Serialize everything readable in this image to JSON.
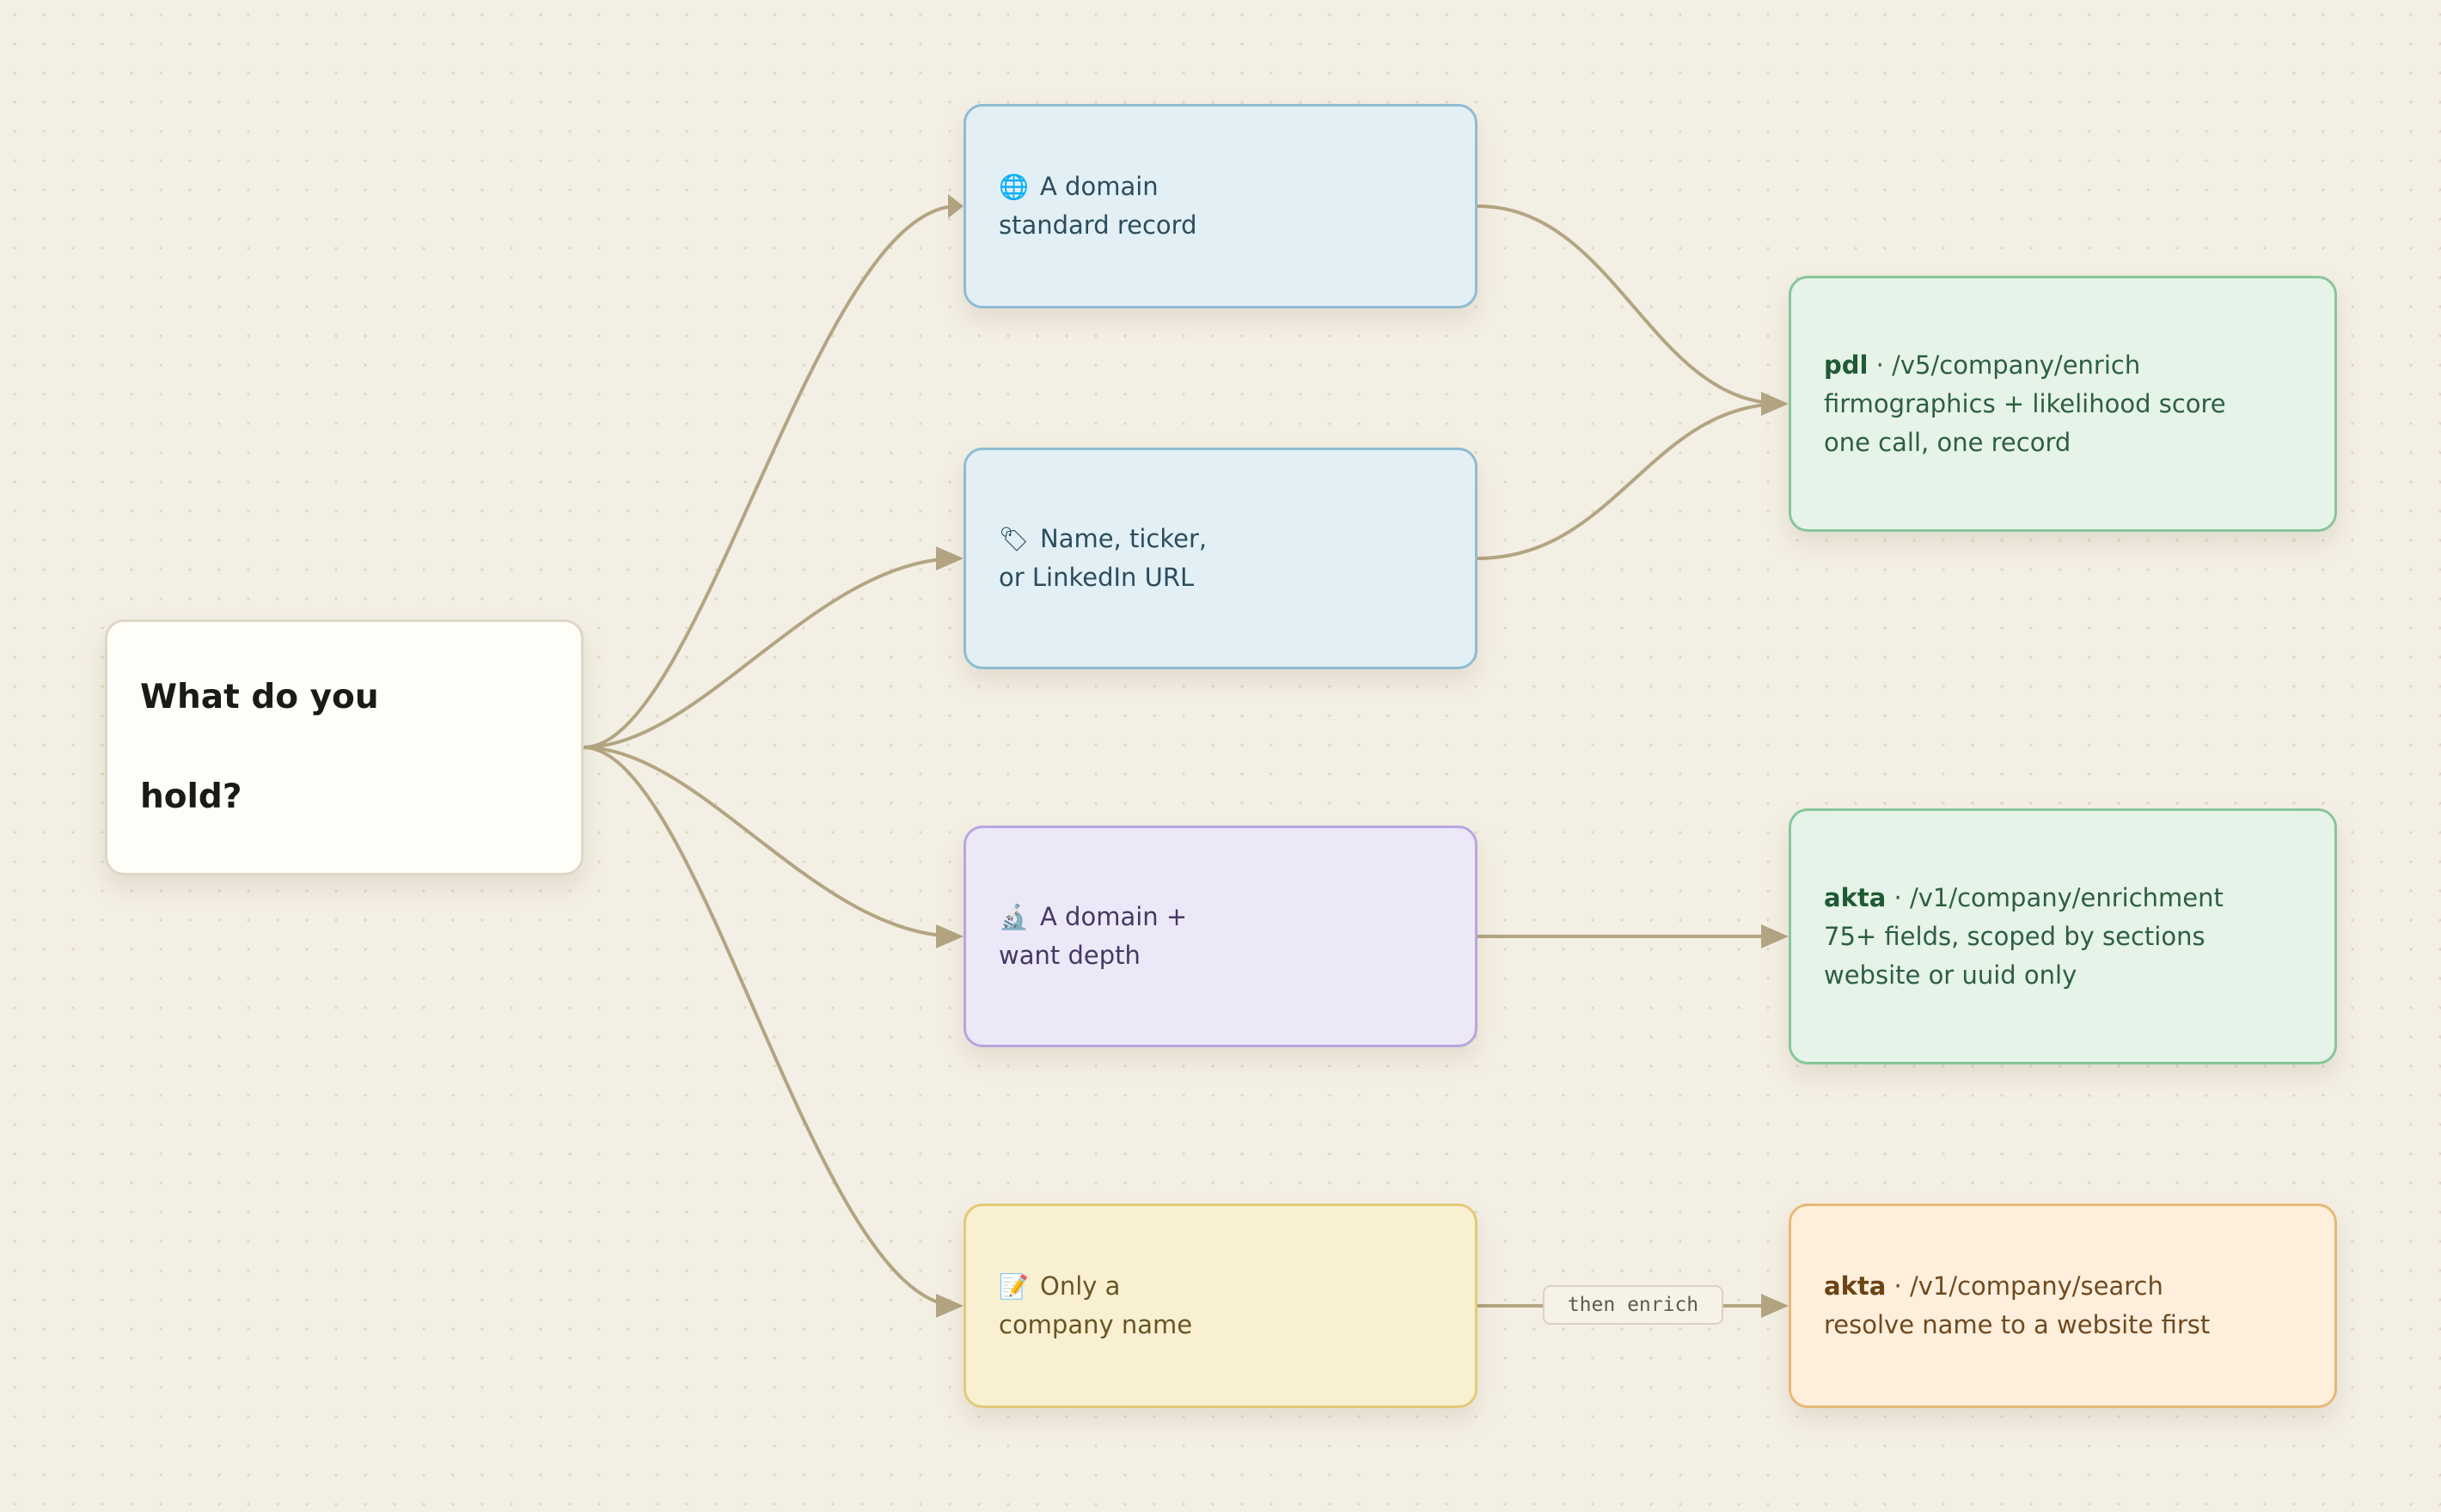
{
  "root": {
    "line1": "What do you",
    "line2": "hold?"
  },
  "inputs": [
    {
      "key": "domain",
      "icon": "globe-icon",
      "glyph": "🌐",
      "line1": "A domain",
      "line2": "standard record"
    },
    {
      "key": "name",
      "icon": "tag-icon",
      "glyph": "🏷",
      "line1": "Name, ticker,",
      "line2": "or LinkedIn URL"
    },
    {
      "key": "depth",
      "icon": "microscope-icon",
      "glyph": "🔬",
      "line1": "A domain +",
      "line2": "want depth"
    },
    {
      "key": "company",
      "icon": "memo-icon",
      "glyph": "📝",
      "line1": "Only a",
      "line2": "company name"
    }
  ],
  "endpoints": [
    {
      "key": "pdl",
      "provider": "pdl",
      "path": " · /v5/company/enrich",
      "lines": [
        "firmographics + likelihood score",
        "one call, one record"
      ]
    },
    {
      "key": "enrich",
      "provider": "akta",
      "path": " · /v1/company/enrichment",
      "lines": [
        "75+ fields, scoped by sections",
        "website or uuid only"
      ]
    },
    {
      "key": "search",
      "provider": "akta",
      "path": " · /v1/company/search",
      "lines": [
        "resolve name to a website first"
      ]
    }
  ],
  "edge_label": "then enrich",
  "colors": {
    "edge": "#b3a582",
    "input_blue": "#e2eff4",
    "input_purple": "#ede8f8",
    "input_yellow": "#f8f0d1",
    "endpoint_green": "#e6f3e8",
    "endpoint_orange": "#fdefdc"
  }
}
